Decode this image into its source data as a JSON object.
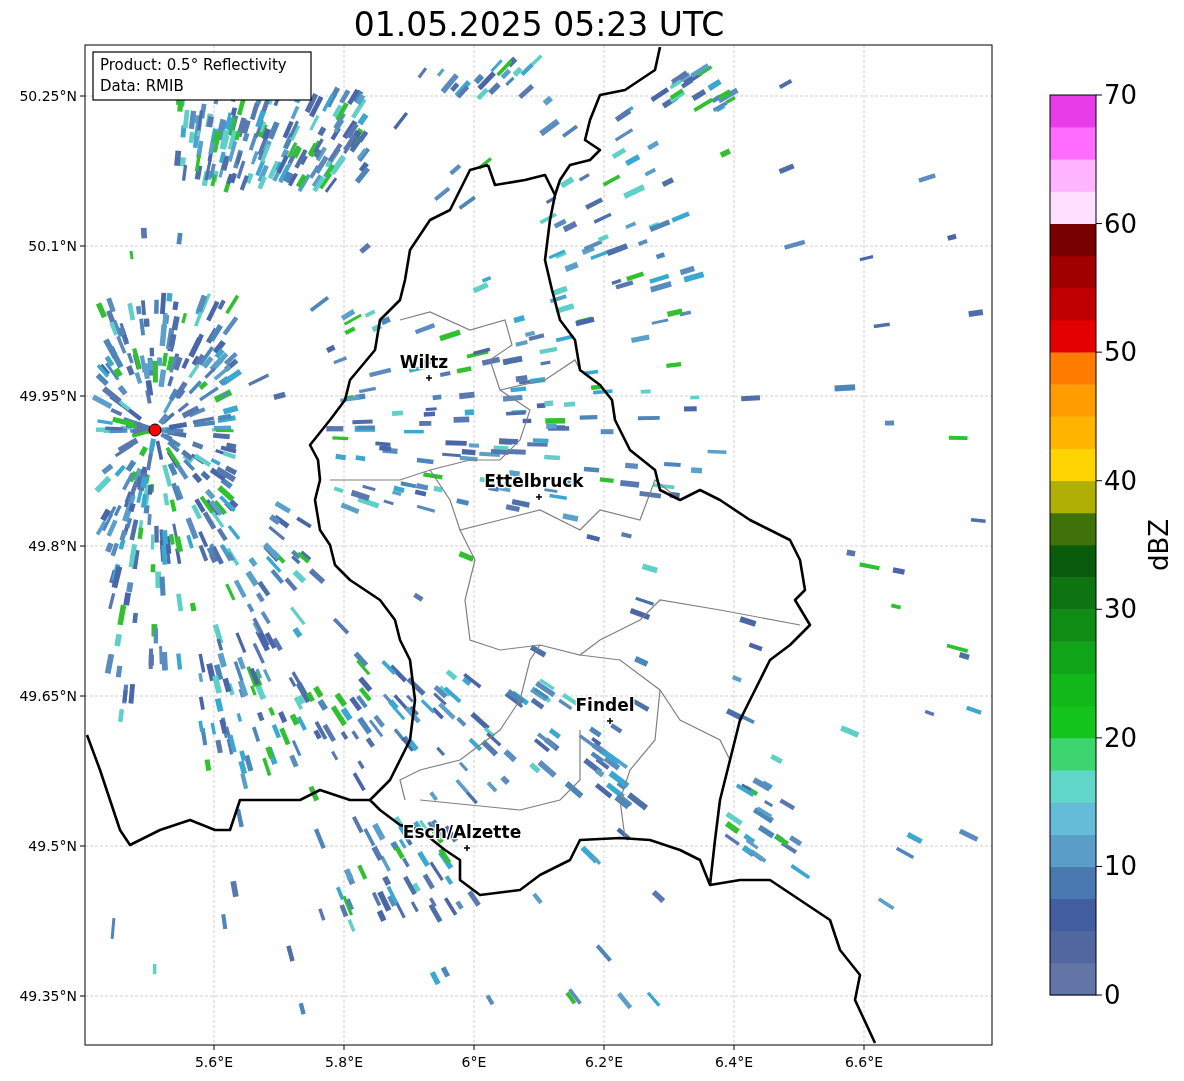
{
  "title": "01.05.2025 05:23 UTC",
  "info_box": {
    "lines": [
      "Product: 0.5° Reflectivity",
      "Data: RMIB"
    ]
  },
  "map": {
    "x_ticks": [
      "5.6°E",
      "5.8°E",
      "6°E",
      "6.2°E",
      "6.4°E",
      "6.6°E"
    ],
    "y_ticks": [
      "50.25°N",
      "50.1°N",
      "49.95°N",
      "49.8°N",
      "49.65°N",
      "49.5°N",
      "49.35°N"
    ],
    "places": [
      {
        "name": "Wiltz"
      },
      {
        "name": "Ettelbruck"
      },
      {
        "name": "Findel"
      },
      {
        "name": "Esch/Alzette"
      }
    ]
  },
  "colorbar": {
    "label": "dBZ",
    "ticks": [
      "70",
      "60",
      "50",
      "40",
      "30",
      "20",
      "10",
      "0"
    ],
    "bins": [
      {
        "color": "#6374a6"
      },
      {
        "color": "#5266a0"
      },
      {
        "color": "#435ea0"
      },
      {
        "color": "#4a78b0"
      },
      {
        "color": "#5a9dc8"
      },
      {
        "color": "#64bcd8"
      },
      {
        "color": "#5fd6c8"
      },
      {
        "color": "#3dd66e"
      },
      {
        "color": "#12c41c"
      },
      {
        "color": "#10b81a"
      },
      {
        "color": "#10a418"
      },
      {
        "color": "#0e8c14"
      },
      {
        "color": "#0c7410"
      },
      {
        "color": "#085c0c"
      },
      {
        "color": "#3f7208"
      },
      {
        "color": "#b0b004"
      },
      {
        "color": "#ffd400"
      },
      {
        "color": "#ffb400"
      },
      {
        "color": "#ff9c00"
      },
      {
        "color": "#ff7c00"
      },
      {
        "color": "#e40000"
      },
      {
        "color": "#c00000"
      },
      {
        "color": "#a00000"
      },
      {
        "color": "#780000"
      },
      {
        "color": "#ffe0ff"
      },
      {
        "color": "#ffb4ff"
      },
      {
        "color": "#ff6cff"
      },
      {
        "color": "#e83ce8"
      }
    ]
  }
}
